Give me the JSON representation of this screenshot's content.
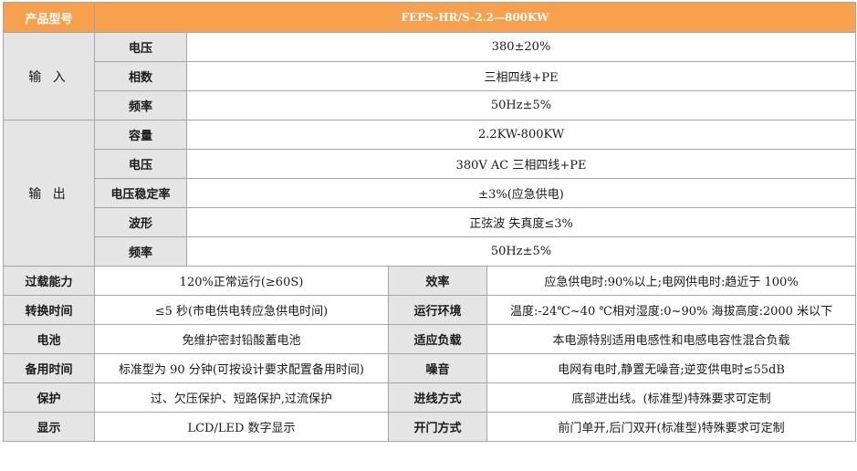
{
  "header": {
    "label": "产品型号",
    "model": "FEPS-HR/S-2.2—800KW"
  },
  "input": {
    "title": "输 入",
    "rows": [
      {
        "label": "电压",
        "value": "380±20%"
      },
      {
        "label": "相数",
        "value": "三相四线+PE"
      },
      {
        "label": "频率",
        "value": "50Hz±5%"
      }
    ]
  },
  "output": {
    "title": "输 出",
    "rows": [
      {
        "label": "容量",
        "value": "2.2KW-800KW"
      },
      {
        "label": "电压",
        "value": "380V AC 三相四线+PE"
      },
      {
        "label": "电压稳定率",
        "value": "±3%(应急供电)"
      },
      {
        "label": "波形",
        "value": "正弦波 失真度≤3%"
      },
      {
        "label": "频率",
        "value": "50Hz±5%"
      }
    ]
  },
  "specs": [
    {
      "l1": "过载能力",
      "v1": "120%正常运行(≥60S)",
      "l2": "效率",
      "v2": "应急供电时:90%以上;电网供电时:趋近于 100%"
    },
    {
      "l1": "转换时间",
      "v1": "≤5 秒(市电供电转应急供电时间)",
      "l2": "运行环境",
      "v2": "温度:-24℃~40 ℃相对湿度:0~90% 海拔高度:2000 米以下"
    },
    {
      "l1": "电池",
      "v1": "免维护密封铅酸蓄电池",
      "l2": "适应负载",
      "v2": "本电源特别适用电感性和电感电容性混合负载"
    },
    {
      "l1": "备用时间",
      "v1": "标准型为 90 分钟(可按设计要求配置备用时间)",
      "l2": "噪音",
      "v2": "电网有电时,静置无噪音;逆变供电时≤55dB"
    },
    {
      "l1": "保护",
      "v1": "过、欠压保护、短路保护,过流保护",
      "l2": "进线方式",
      "v2": "底部进出线。(标准型)特殊要求可定制"
    },
    {
      "l1": "显示",
      "v1": "LCD/LED 数字显示",
      "l2": "开门方式",
      "v2": "前门单开,后门双开(标准型)特殊要求可定制"
    }
  ]
}
